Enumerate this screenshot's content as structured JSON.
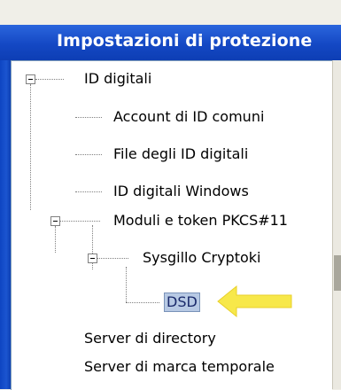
{
  "window": {
    "title": "Impostazioni di protezione"
  },
  "tree": {
    "root_label": "ID digitali",
    "items": [
      {
        "label": "Account di ID comuni"
      },
      {
        "label": "File degli ID digitali"
      },
      {
        "label": "ID digitali Windows"
      },
      {
        "label": "Moduli e token PKCS#11"
      },
      {
        "label": "Sysgillo Cryptoki"
      },
      {
        "label": "DSD"
      }
    ],
    "server_directory": "Server di directory",
    "server_timestamp": "Server di marca temporale"
  },
  "colors": {
    "title_bar": "#1448c4",
    "selection": "#b7c9e4",
    "arrow": "#f7e84a"
  },
  "icons": {
    "expander": "minus-box",
    "pointer": "yellow-arrow-left"
  }
}
